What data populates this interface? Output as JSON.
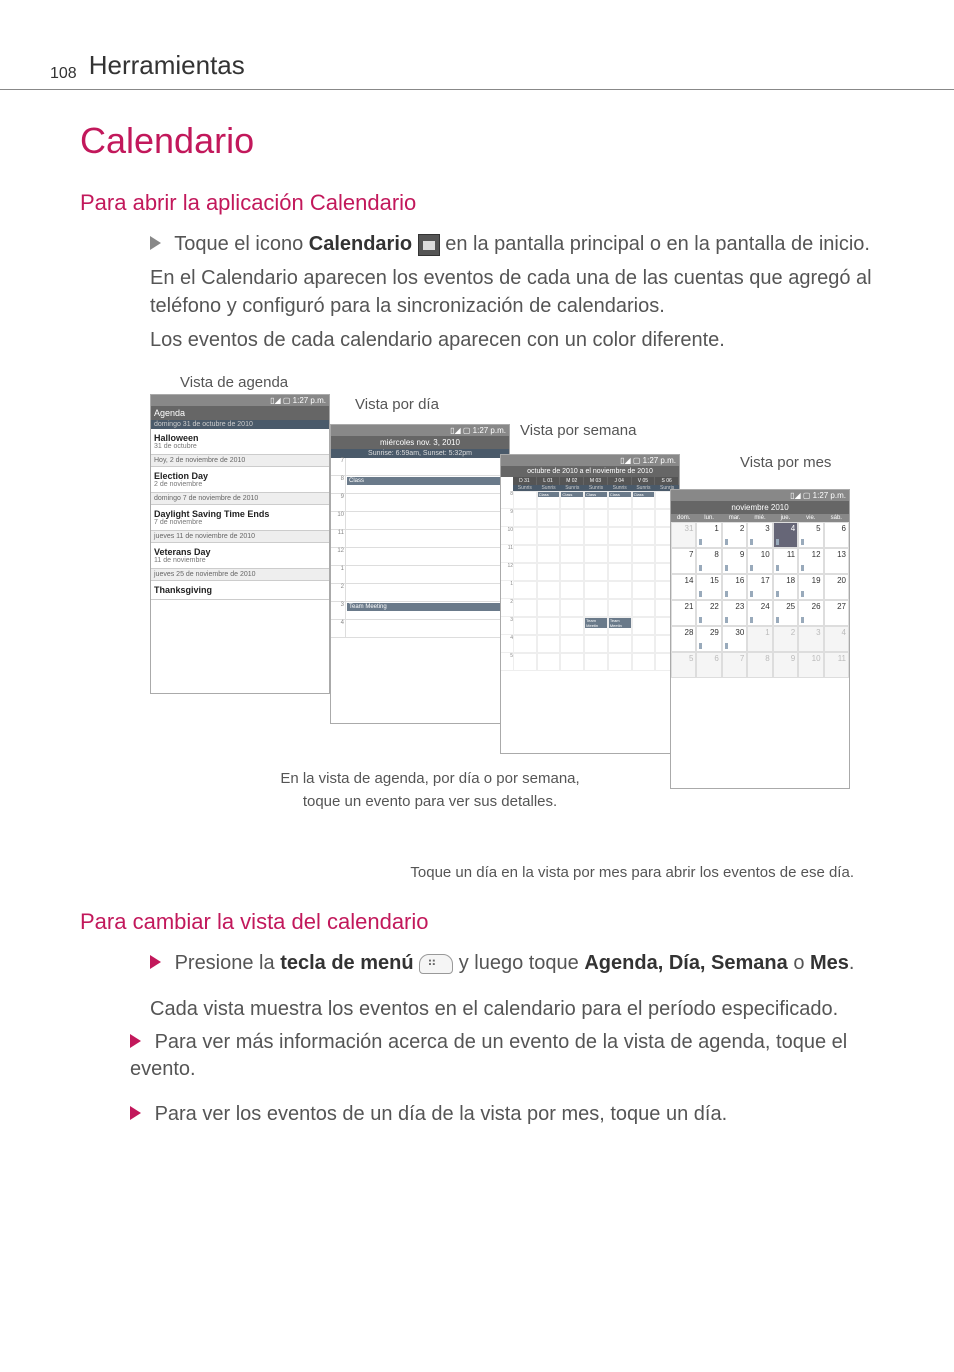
{
  "page": {
    "number": "108",
    "header": "Herramientas"
  },
  "h1": "Calendario",
  "section1": {
    "heading": "Para abrir la aplicación Calendario",
    "line1_pre": "Toque el icono ",
    "line1_bold": "Calendario",
    "line1_post": " en la pantalla principal o en la pantalla de inicio.",
    "para2": "En el Calendario aparecen los eventos de cada una de las cuentas que agregó al teléfono y configuró para la sincronización de calendarios.",
    "para3": "Los eventos de cada calendario aparecen con un color diferente."
  },
  "labels": {
    "agenda": "Vista de agenda",
    "day": "Vista por día",
    "week": "Vista por semana",
    "month": "Vista por mes"
  },
  "status_time": "1:27 p.m.",
  "agenda": {
    "title": "Agenda",
    "sub": "domingo 31 de octubre de 2010",
    "items": [
      {
        "title": "Halloween",
        "sub": "31 de octubre"
      },
      {
        "div": "Hoy, 2 de noviembre de 2010"
      },
      {
        "title": "Election Day",
        "sub": "2 de noviembre"
      },
      {
        "div": "domingo 7 de noviembre de 2010"
      },
      {
        "title": "Daylight Saving Time Ends",
        "sub": "7 de noviembre"
      },
      {
        "div": "jueves 11 de noviembre de 2010"
      },
      {
        "title": "Veterans Day",
        "sub": "11 de noviembre"
      },
      {
        "div": "jueves 25 de noviembre de 2010"
      },
      {
        "title": "Thanksgiving",
        "sub": ""
      }
    ]
  },
  "day_view": {
    "title": "miércoles nov. 3, 2010",
    "sub": "Sunrise: 6:59am, Sunset: 5:32pm",
    "hours": [
      "7",
      "8",
      "9",
      "10",
      "11",
      "12",
      "1",
      "2",
      "3",
      "4"
    ],
    "ev_class": "Class",
    "ev_team": "Team Meeting"
  },
  "week_view": {
    "title": "octubre de 2010 a el noviembre de 2010",
    "day_heads": [
      "D 31",
      "L 01",
      "M 02",
      "M 03",
      "J 04",
      "V 05",
      "S 06"
    ],
    "sun": "Sunris",
    "ev_class": "Class",
    "ev_team": "Team Meetin"
  },
  "month_view": {
    "title": "noviembre 2010",
    "day_heads": [
      "dom.",
      "lun.",
      "mar.",
      "mié.",
      "jue.",
      "vie.",
      "sáb."
    ],
    "grid": [
      [
        "31",
        "1",
        "2",
        "3",
        "4",
        "5",
        "6"
      ],
      [
        "7",
        "8",
        "9",
        "10",
        "11",
        "12",
        "13"
      ],
      [
        "14",
        "15",
        "16",
        "17",
        "18",
        "19",
        "20"
      ],
      [
        "21",
        "22",
        "23",
        "24",
        "25",
        "26",
        "27"
      ],
      [
        "28",
        "29",
        "30",
        "1",
        "2",
        "3",
        "4"
      ],
      [
        "5",
        "6",
        "7",
        "8",
        "9",
        "10",
        "11"
      ]
    ]
  },
  "caption1a": "En la vista de agenda, por día o por semana,",
  "caption1b": "toque un evento para ver sus detalles.",
  "caption2": "Toque un día en la vista por mes para abrir los eventos de ese día.",
  "section2": {
    "heading": "Para cambiar la vista del calendario",
    "line1_pre": "Presione la ",
    "line1_bold1": "tecla de menú",
    "line1_mid": " y luego toque ",
    "line1_bold2": "Agenda, Día, Semana",
    "line1_o": " o ",
    "line1_bold3": "Mes",
    "para2": "Cada vista muestra los eventos en el calendario para el período especificado.",
    "bullet1": "Para ver más información acerca de un evento de la vista de agenda, toque el evento.",
    "bullet2": "Para ver los eventos de un día de la vista por mes, toque un día."
  }
}
